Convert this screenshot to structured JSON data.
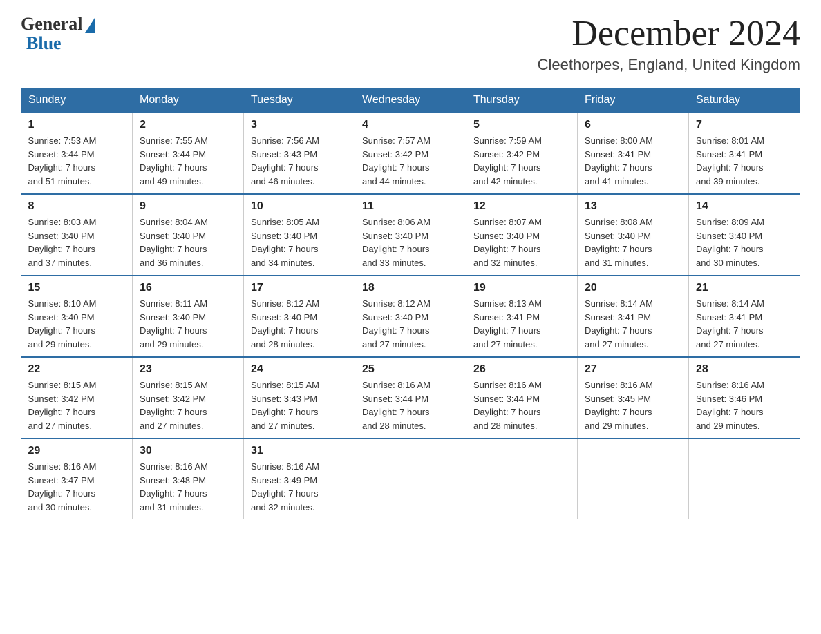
{
  "logo": {
    "general": "General",
    "blue": "Blue"
  },
  "header": {
    "month": "December 2024",
    "location": "Cleethorpes, England, United Kingdom"
  },
  "weekdays": [
    "Sunday",
    "Monday",
    "Tuesday",
    "Wednesday",
    "Thursday",
    "Friday",
    "Saturday"
  ],
  "weeks": [
    [
      {
        "day": "1",
        "info": "Sunrise: 7:53 AM\nSunset: 3:44 PM\nDaylight: 7 hours\nand 51 minutes."
      },
      {
        "day": "2",
        "info": "Sunrise: 7:55 AM\nSunset: 3:44 PM\nDaylight: 7 hours\nand 49 minutes."
      },
      {
        "day": "3",
        "info": "Sunrise: 7:56 AM\nSunset: 3:43 PM\nDaylight: 7 hours\nand 46 minutes."
      },
      {
        "day": "4",
        "info": "Sunrise: 7:57 AM\nSunset: 3:42 PM\nDaylight: 7 hours\nand 44 minutes."
      },
      {
        "day": "5",
        "info": "Sunrise: 7:59 AM\nSunset: 3:42 PM\nDaylight: 7 hours\nand 42 minutes."
      },
      {
        "day": "6",
        "info": "Sunrise: 8:00 AM\nSunset: 3:41 PM\nDaylight: 7 hours\nand 41 minutes."
      },
      {
        "day": "7",
        "info": "Sunrise: 8:01 AM\nSunset: 3:41 PM\nDaylight: 7 hours\nand 39 minutes."
      }
    ],
    [
      {
        "day": "8",
        "info": "Sunrise: 8:03 AM\nSunset: 3:40 PM\nDaylight: 7 hours\nand 37 minutes."
      },
      {
        "day": "9",
        "info": "Sunrise: 8:04 AM\nSunset: 3:40 PM\nDaylight: 7 hours\nand 36 minutes."
      },
      {
        "day": "10",
        "info": "Sunrise: 8:05 AM\nSunset: 3:40 PM\nDaylight: 7 hours\nand 34 minutes."
      },
      {
        "day": "11",
        "info": "Sunrise: 8:06 AM\nSunset: 3:40 PM\nDaylight: 7 hours\nand 33 minutes."
      },
      {
        "day": "12",
        "info": "Sunrise: 8:07 AM\nSunset: 3:40 PM\nDaylight: 7 hours\nand 32 minutes."
      },
      {
        "day": "13",
        "info": "Sunrise: 8:08 AM\nSunset: 3:40 PM\nDaylight: 7 hours\nand 31 minutes."
      },
      {
        "day": "14",
        "info": "Sunrise: 8:09 AM\nSunset: 3:40 PM\nDaylight: 7 hours\nand 30 minutes."
      }
    ],
    [
      {
        "day": "15",
        "info": "Sunrise: 8:10 AM\nSunset: 3:40 PM\nDaylight: 7 hours\nand 29 minutes."
      },
      {
        "day": "16",
        "info": "Sunrise: 8:11 AM\nSunset: 3:40 PM\nDaylight: 7 hours\nand 29 minutes."
      },
      {
        "day": "17",
        "info": "Sunrise: 8:12 AM\nSunset: 3:40 PM\nDaylight: 7 hours\nand 28 minutes."
      },
      {
        "day": "18",
        "info": "Sunrise: 8:12 AM\nSunset: 3:40 PM\nDaylight: 7 hours\nand 27 minutes."
      },
      {
        "day": "19",
        "info": "Sunrise: 8:13 AM\nSunset: 3:41 PM\nDaylight: 7 hours\nand 27 minutes."
      },
      {
        "day": "20",
        "info": "Sunrise: 8:14 AM\nSunset: 3:41 PM\nDaylight: 7 hours\nand 27 minutes."
      },
      {
        "day": "21",
        "info": "Sunrise: 8:14 AM\nSunset: 3:41 PM\nDaylight: 7 hours\nand 27 minutes."
      }
    ],
    [
      {
        "day": "22",
        "info": "Sunrise: 8:15 AM\nSunset: 3:42 PM\nDaylight: 7 hours\nand 27 minutes."
      },
      {
        "day": "23",
        "info": "Sunrise: 8:15 AM\nSunset: 3:42 PM\nDaylight: 7 hours\nand 27 minutes."
      },
      {
        "day": "24",
        "info": "Sunrise: 8:15 AM\nSunset: 3:43 PM\nDaylight: 7 hours\nand 27 minutes."
      },
      {
        "day": "25",
        "info": "Sunrise: 8:16 AM\nSunset: 3:44 PM\nDaylight: 7 hours\nand 28 minutes."
      },
      {
        "day": "26",
        "info": "Sunrise: 8:16 AM\nSunset: 3:44 PM\nDaylight: 7 hours\nand 28 minutes."
      },
      {
        "day": "27",
        "info": "Sunrise: 8:16 AM\nSunset: 3:45 PM\nDaylight: 7 hours\nand 29 minutes."
      },
      {
        "day": "28",
        "info": "Sunrise: 8:16 AM\nSunset: 3:46 PM\nDaylight: 7 hours\nand 29 minutes."
      }
    ],
    [
      {
        "day": "29",
        "info": "Sunrise: 8:16 AM\nSunset: 3:47 PM\nDaylight: 7 hours\nand 30 minutes."
      },
      {
        "day": "30",
        "info": "Sunrise: 8:16 AM\nSunset: 3:48 PM\nDaylight: 7 hours\nand 31 minutes."
      },
      {
        "day": "31",
        "info": "Sunrise: 8:16 AM\nSunset: 3:49 PM\nDaylight: 7 hours\nand 32 minutes."
      },
      null,
      null,
      null,
      null
    ]
  ]
}
